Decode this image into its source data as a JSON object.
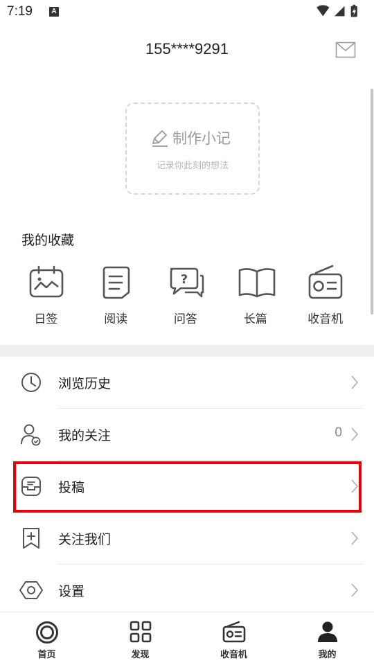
{
  "status_bar": {
    "time": "7:19",
    "notification_badge": "A",
    "icons": [
      "wifi-icon",
      "signal-icon",
      "battery-icon"
    ]
  },
  "header": {
    "title": "155****9291",
    "mail_icon": "mail-icon"
  },
  "note_card": {
    "title": "制作小记",
    "subtitle": "记录你此刻的想法",
    "icon": "pencil-icon"
  },
  "favorites": {
    "title": "我的收藏",
    "items": [
      {
        "label": "日签",
        "icon": "calendar-image-icon"
      },
      {
        "label": "阅读",
        "icon": "document-icon"
      },
      {
        "label": "问答",
        "icon": "question-chat-icon"
      },
      {
        "label": "长篇",
        "icon": "open-book-icon"
      },
      {
        "label": "收音机",
        "icon": "radio-icon"
      }
    ]
  },
  "menu": [
    {
      "label": "浏览历史",
      "icon": "clock-icon",
      "count": ""
    },
    {
      "label": "我的关注",
      "icon": "user-check-icon",
      "count": "0"
    },
    {
      "label": "投稿",
      "icon": "submission-icon",
      "count": ""
    },
    {
      "label": "关注我们",
      "icon": "bookmark-plus-icon",
      "count": ""
    },
    {
      "label": "设置",
      "icon": "settings-hexagon-icon",
      "count": ""
    }
  ],
  "bottom_nav": [
    {
      "label": "首页",
      "icon": "home-circle-icon"
    },
    {
      "label": "发现",
      "icon": "grid-icon"
    },
    {
      "label": "收音机",
      "icon": "radio-icon"
    },
    {
      "label": "我的",
      "icon": "person-icon"
    }
  ],
  "colors": {
    "highlight": "#e8000b",
    "divider": "#eeeeee",
    "icon_gray": "#555555"
  }
}
